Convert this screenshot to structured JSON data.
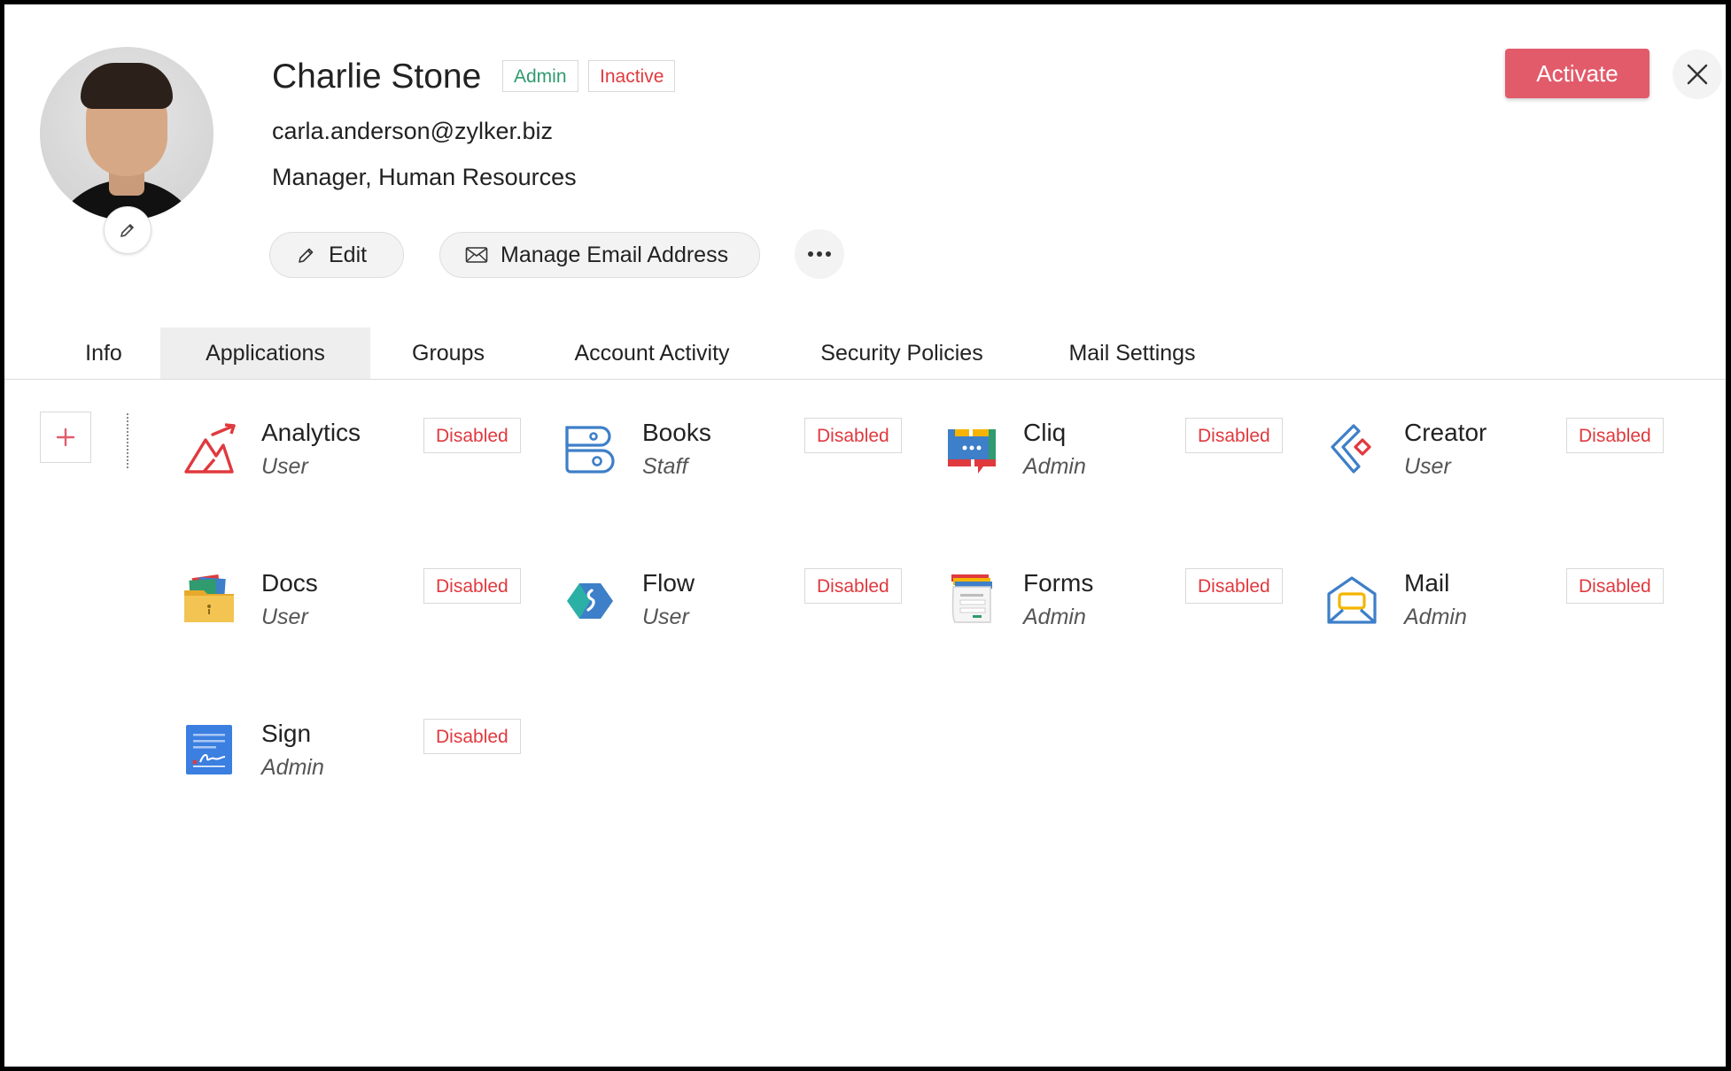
{
  "profile": {
    "name": "Charlie Stone",
    "badge_role": "Admin",
    "badge_status": "Inactive",
    "email": "carla.anderson@zylker.biz",
    "designation": "Manager, Human Resources"
  },
  "actions": {
    "edit_label": "Edit",
    "manage_email_label": "Manage Email Address",
    "activate_label": "Activate"
  },
  "tabs": [
    {
      "label": "Info"
    },
    {
      "label": "Applications"
    },
    {
      "label": "Groups"
    },
    {
      "label": "Account Activity"
    },
    {
      "label": "Security Policies"
    },
    {
      "label": "Mail Settings"
    }
  ],
  "active_tab": "Applications",
  "apps": [
    {
      "name": "Analytics",
      "role": "User",
      "status": "Disabled",
      "icon": "analytics-icon"
    },
    {
      "name": "Books",
      "role": "Staff",
      "status": "Disabled",
      "icon": "books-icon"
    },
    {
      "name": "Cliq",
      "role": "Admin",
      "status": "Disabled",
      "icon": "cliq-icon"
    },
    {
      "name": "Creator",
      "role": "User",
      "status": "Disabled",
      "icon": "creator-icon"
    },
    {
      "name": "Docs",
      "role": "User",
      "status": "Disabled",
      "icon": "docs-icon"
    },
    {
      "name": "Flow",
      "role": "User",
      "status": "Disabled",
      "icon": "flow-icon"
    },
    {
      "name": "Forms",
      "role": "Admin",
      "status": "Disabled",
      "icon": "forms-icon"
    },
    {
      "name": "Mail",
      "role": "Admin",
      "status": "Disabled",
      "icon": "mail-icon"
    },
    {
      "name": "Sign",
      "role": "Admin",
      "status": "Disabled",
      "icon": "sign-icon"
    }
  ],
  "colors": {
    "accent": "#e25b6b",
    "admin_badge": "#2f9b6e",
    "inactive_badge": "#e0393e",
    "disabled_status": "#e0393e"
  }
}
